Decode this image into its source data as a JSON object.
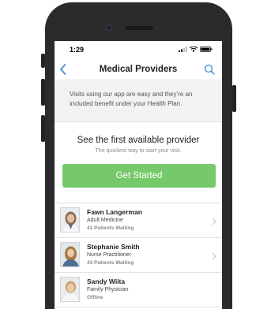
{
  "status_bar": {
    "time": "1:29"
  },
  "nav": {
    "title": "Medical Providers",
    "back_icon": "chevron-left-icon",
    "search_icon": "search-icon"
  },
  "intro": {
    "text": "Visits using our app are easy and they’re an included benefit under your Health Plan."
  },
  "first_available": {
    "title": "See the first available provider",
    "subtitle": "The quickest way to start your visit.",
    "button_label": "Get Started"
  },
  "colors": {
    "accent": "#4a90d9",
    "cta": "#76c96a",
    "intro_bg": "#f2f2f4"
  },
  "providers": [
    {
      "name": "Fawn Langerman",
      "specialty": "Adult Medicine",
      "status": "41 Patients Waiting"
    },
    {
      "name": "Stephanie Smith",
      "specialty": "Nurse Practitioner",
      "status": "43 Patients Waiting"
    },
    {
      "name": "Sandy Wiita",
      "specialty": "Family Physician",
      "status": "Offline"
    }
  ]
}
